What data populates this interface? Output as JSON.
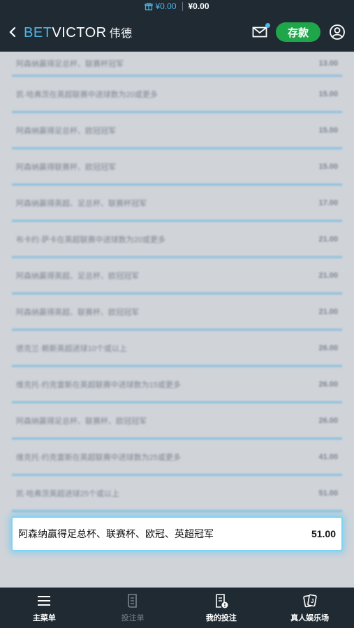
{
  "status_bar": {
    "bonus_amount": "¥0.00",
    "cash_amount": "¥0.00"
  },
  "header": {
    "logo_bet": "BET",
    "logo_victor": "VICTOR",
    "logo_cn": "伟德",
    "deposit_label": "存款"
  },
  "bets": [
    {
      "name": "阿森纳赢得足总杯、联赛杯冠军",
      "odds": "13.00"
    },
    {
      "name": "凯·哈弗茨在英超联赛中进球数为20或更多",
      "odds": "15.00"
    },
    {
      "name": "阿森纳赢得足总杯、欧冠冠军",
      "odds": "15.00"
    },
    {
      "name": "阿森纳赢得联赛杯、欧冠冠军",
      "odds": "15.00"
    },
    {
      "name": "阿森纳赢得英超、足总杯、联赛杯冠军",
      "odds": "17.00"
    },
    {
      "name": "布卡约·萨卡在英超联赛中进球数为20或更多",
      "odds": "21.00"
    },
    {
      "name": "阿森纳赢得英超、足总杯、欧冠冠军",
      "odds": "21.00"
    },
    {
      "name": "阿森纳赢得英超、联赛杯、欧冠冠军",
      "odds": "21.00"
    },
    {
      "name": "德克兰·赖斯英超进球10个或以上",
      "odds": "26.00"
    },
    {
      "name": "维克托·约克雷斯在英超联赛中进球数为15或更多",
      "odds": "26.00"
    },
    {
      "name": "阿森纳赢得足总杯、联赛杯、欧冠冠军",
      "odds": "26.00"
    },
    {
      "name": "维克托·约克雷斯在英超联赛中进球数为25或更多",
      "odds": "41.00"
    },
    {
      "name": "凯·哈弗茨英超进球25个或以上",
      "odds": "51.00"
    }
  ],
  "selected_bet": {
    "name": "阿森纳赢得足总杯、联赛杯、欧冠、英超冠军",
    "odds": "51.00"
  },
  "bottom_nav": {
    "menu": "主菜单",
    "betslip": "投注单",
    "my_bets": "我的投注",
    "casino": "真人娱乐场"
  },
  "colors": {
    "accent_blue": "#4fb6e6",
    "deposit_green": "#1fa64a",
    "navy": "#1f2a33"
  }
}
